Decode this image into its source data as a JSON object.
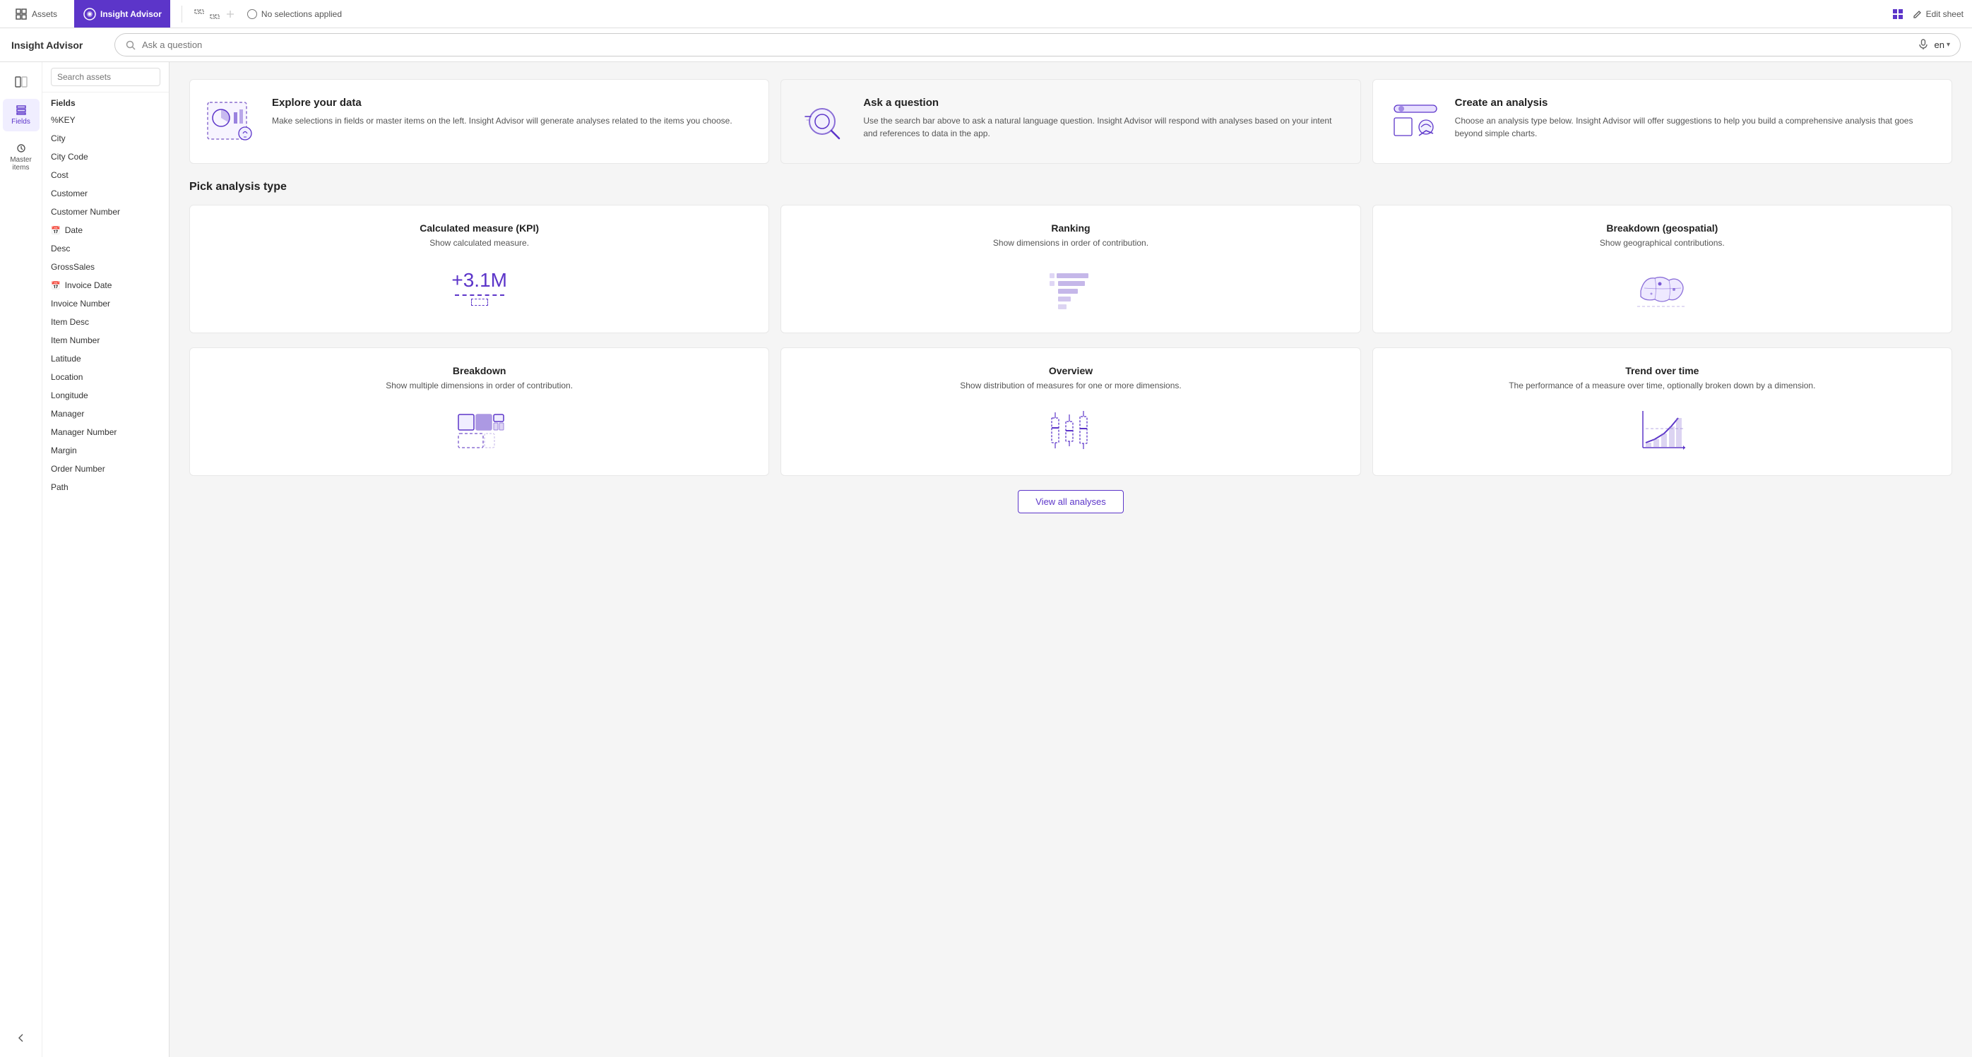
{
  "topbar": {
    "assets_label": "Assets",
    "insight_label": "Insight Advisor",
    "no_selections": "No selections applied",
    "edit_sheet": "Edit sheet",
    "lang": "en"
  },
  "secondbar": {
    "title": "Insight Advisor",
    "search_placeholder": "Ask a question"
  },
  "sidebar": {
    "search_placeholder": "Search assets",
    "fields_label": "Fields",
    "master_items_label": "Master items",
    "fields_section": "Fields",
    "items": [
      {
        "label": "%KEY",
        "icon": ""
      },
      {
        "label": "City",
        "icon": ""
      },
      {
        "label": "City Code",
        "icon": ""
      },
      {
        "label": "Cost",
        "icon": ""
      },
      {
        "label": "Customer",
        "icon": ""
      },
      {
        "label": "Customer Number",
        "icon": ""
      },
      {
        "label": "Date",
        "icon": "calendar"
      },
      {
        "label": "Desc",
        "icon": ""
      },
      {
        "label": "GrossSales",
        "icon": ""
      },
      {
        "label": "Invoice Date",
        "icon": "calendar"
      },
      {
        "label": "Invoice Number",
        "icon": ""
      },
      {
        "label": "Item Desc",
        "icon": ""
      },
      {
        "label": "Item Number",
        "icon": ""
      },
      {
        "label": "Latitude",
        "icon": ""
      },
      {
        "label": "Location",
        "icon": ""
      },
      {
        "label": "Longitude",
        "icon": ""
      },
      {
        "label": "Manager",
        "icon": ""
      },
      {
        "label": "Manager Number",
        "icon": ""
      },
      {
        "label": "Margin",
        "icon": ""
      },
      {
        "label": "Order Number",
        "icon": ""
      },
      {
        "label": "Path",
        "icon": ""
      }
    ]
  },
  "info_cards": [
    {
      "id": "explore",
      "title": "Explore your data",
      "description": "Make selections in fields or master items on the left. Insight Advisor will generate analyses related to the items you choose."
    },
    {
      "id": "ask",
      "title": "Ask a question",
      "description": "Use the search bar above to ask a natural language question. Insight Advisor will respond with analyses based on your intent and references to data in the app."
    },
    {
      "id": "create",
      "title": "Create an analysis",
      "description": "Choose an analysis type below. Insight Advisor will offer suggestions to help you build a comprehensive analysis that goes beyond simple charts."
    }
  ],
  "analysis_section": {
    "title": "Pick analysis type",
    "view_all_label": "View all analyses",
    "cards": [
      {
        "id": "kpi",
        "title": "Calculated measure (KPI)",
        "description": "Show calculated measure.",
        "kpi_value": "+3.1M"
      },
      {
        "id": "ranking",
        "title": "Ranking",
        "description": "Show dimensions in order of contribution."
      },
      {
        "id": "geo",
        "title": "Breakdown (geospatial)",
        "description": "Show geographical contributions."
      },
      {
        "id": "breakdown",
        "title": "Breakdown",
        "description": "Show multiple dimensions in order of contribution."
      },
      {
        "id": "overview",
        "title": "Overview",
        "description": "Show distribution of measures for one or more dimensions."
      },
      {
        "id": "trend",
        "title": "Trend over time",
        "description": "The performance of a measure over time, optionally broken down by a dimension."
      }
    ]
  }
}
